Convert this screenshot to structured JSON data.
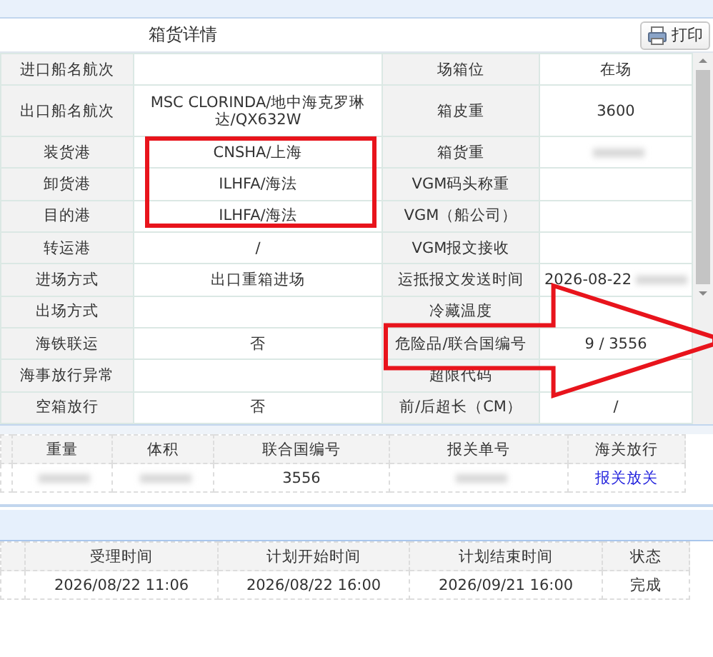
{
  "panel": {
    "title": "箱货详情",
    "print_button": "打印"
  },
  "details": [
    {
      "label": "进口船名航次",
      "label2": "场箱位",
      "value2": "在场"
    },
    {
      "label": "出口船名航次",
      "value": "MSC CLORINDA/地中海克罗琳达/QX632W",
      "label2": "箱皮重",
      "value2": "3600"
    },
    {
      "label": "装货港",
      "value": "CNSHA/上海",
      "label2": "箱货重",
      "redacted2": true
    },
    {
      "label": "卸货港",
      "value": "ILHFA/海法",
      "label2": "VGM码头称重"
    },
    {
      "label": "目的港",
      "value": "ILHFA/海法",
      "label2": "VGM（船公司）"
    },
    {
      "label": "转运港",
      "value": "/",
      "label2": "VGM报文接收"
    },
    {
      "label": "进场方式",
      "value": "出口重箱进场",
      "label2": "运抵报文发送时间",
      "value2": "2026-08-22",
      "redacted2": true
    },
    {
      "label": "出场方式",
      "label2": "冷藏温度"
    },
    {
      "label": "海铁联运",
      "value": "否",
      "label2": "危险品/联合国编号",
      "value2": "9 / 3556"
    },
    {
      "label": "海事放行异常",
      "label2": "超限代码"
    },
    {
      "label": "空箱放行",
      "value": "否",
      "label2": "前/后超长（CM）",
      "value2": "/"
    }
  ],
  "cargo_table": {
    "columns": [
      "重量",
      "体积",
      "联合国编号",
      "报关单号",
      "海关放行"
    ],
    "rows": [
      [
        {
          "redacted": true
        },
        {
          "redacted": true
        },
        {
          "text": "3556"
        },
        {
          "redacted": true
        },
        {
          "text": "报关放关",
          "kind": "link"
        }
      ]
    ]
  },
  "plan_table": {
    "columns": [
      "受理时间",
      "计划开始时间",
      "计划结束时间",
      "状态"
    ],
    "rows": [
      [
        {
          "text": "2026/08/22 11:06"
        },
        {
          "text": "2026/08/22 16:00"
        },
        {
          "text": "2026/09/21 16:00"
        },
        {
          "text": "完成"
        }
      ]
    ]
  },
  "annotations": [
    {
      "kind": "box"
    },
    {
      "kind": "arrow"
    }
  ]
}
